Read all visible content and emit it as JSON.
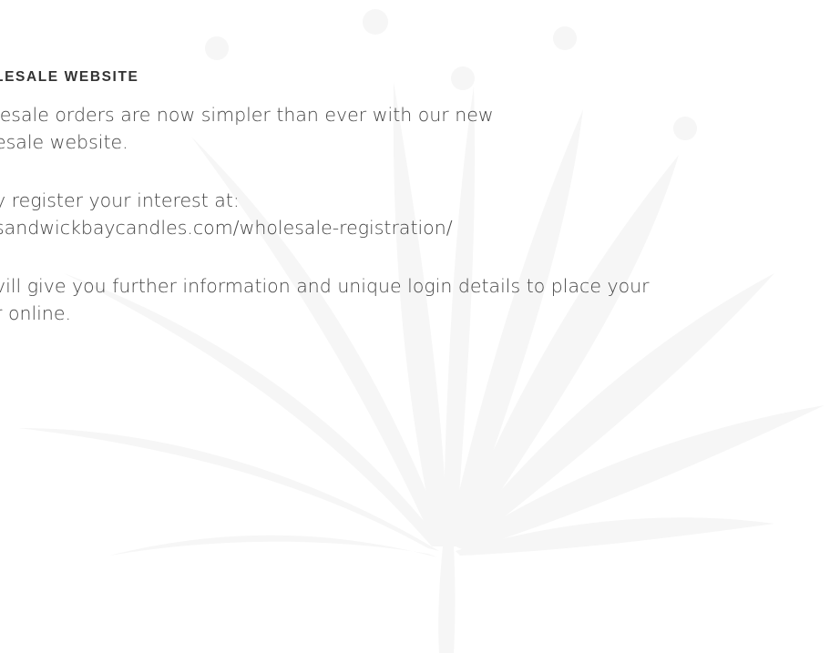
{
  "heading": "LESALE WEBSITE",
  "paragraphs": [
    {
      "lines": [
        "lesale orders are now simpler than ever with our new",
        "esale website."
      ]
    },
    {
      "lines": [
        "y register your interest at:",
        "sandwickbaycandles.com/wholesale-registration/"
      ]
    },
    {
      "lines": [
        "vill give you further information and unique login details to place your",
        "r online."
      ]
    }
  ],
  "colors": {
    "text": "#454545",
    "heading": "#333333",
    "watermark": "#f6f6f6"
  },
  "watermark_icon": "botanical-leaf-spray-icon"
}
